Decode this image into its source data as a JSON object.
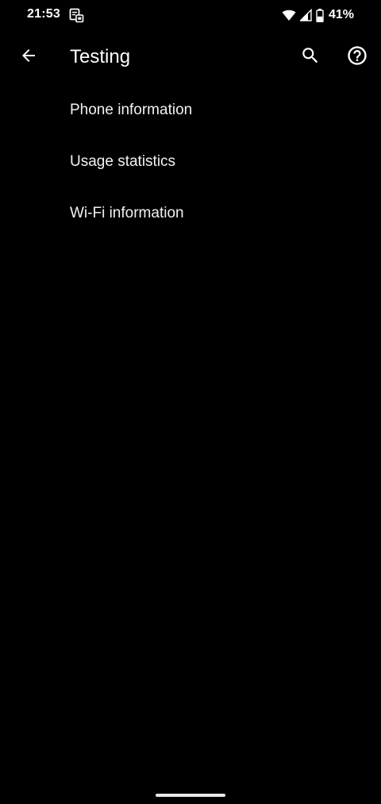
{
  "status_bar": {
    "time": "21:53",
    "notification_icon": "sim-card-notification-icon",
    "wifi_icon": "wifi-icon",
    "signal_icon": "cell-signal-icon",
    "battery_icon": "battery-icon",
    "battery_percent": "41%"
  },
  "app_bar": {
    "back_icon": "arrow-back-icon",
    "title": "Testing",
    "search_icon": "search-icon",
    "help_icon": "help-icon"
  },
  "list": {
    "items": [
      {
        "label": "Phone information"
      },
      {
        "label": "Usage statistics"
      },
      {
        "label": "Wi-Fi information"
      }
    ]
  },
  "colors": {
    "background": "#000000",
    "text_primary": "#ffffff"
  }
}
